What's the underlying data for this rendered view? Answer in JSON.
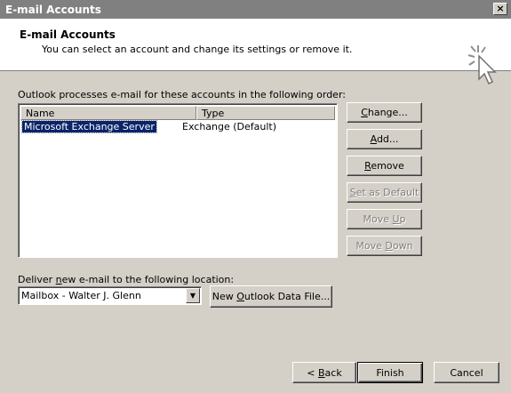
{
  "window": {
    "title": "E-mail Accounts",
    "close_glyph": "×"
  },
  "header": {
    "title": "E-mail Accounts",
    "subtitle": "You can select an account and change its settings or remove it."
  },
  "accounts": {
    "order_label": "Outlook processes e-mail for these accounts in the following order:",
    "columns": [
      "Name",
      "Type"
    ],
    "rows": [
      {
        "name": "Microsoft Exchange Server",
        "type": "Exchange (Default)"
      }
    ]
  },
  "side_buttons": {
    "change": {
      "pre": "",
      "u": "C",
      "post": "hange..."
    },
    "add": {
      "pre": "",
      "u": "A",
      "post": "dd..."
    },
    "remove": {
      "pre": "",
      "u": "R",
      "post": "emove"
    },
    "set_default": {
      "pre": "",
      "u": "S",
      "post": "et as Default"
    },
    "move_up": {
      "pre": "Move ",
      "u": "U",
      "post": "p"
    },
    "move_down": {
      "pre": "Move ",
      "u": "D",
      "post": "own"
    }
  },
  "deliver": {
    "label_pre": "Deliver ",
    "label_u": "n",
    "label_post": "ew e-mail to the following location:",
    "selected": "Mailbox - Walter J. Glenn",
    "new_file": {
      "pre": "New ",
      "u": "O",
      "post": "utlook Data File..."
    }
  },
  "footer": {
    "back": {
      "pre": "< ",
      "u": "B",
      "post": "ack"
    },
    "finish": "Finish",
    "cancel": "Cancel"
  },
  "colors": {
    "selection": "#0a246a",
    "face": "#d4d0c8",
    "title_bar": "#808080"
  },
  "icons": {
    "wizard": "cursor-sparkle-icon",
    "dropdown": "chevron-down-icon"
  }
}
